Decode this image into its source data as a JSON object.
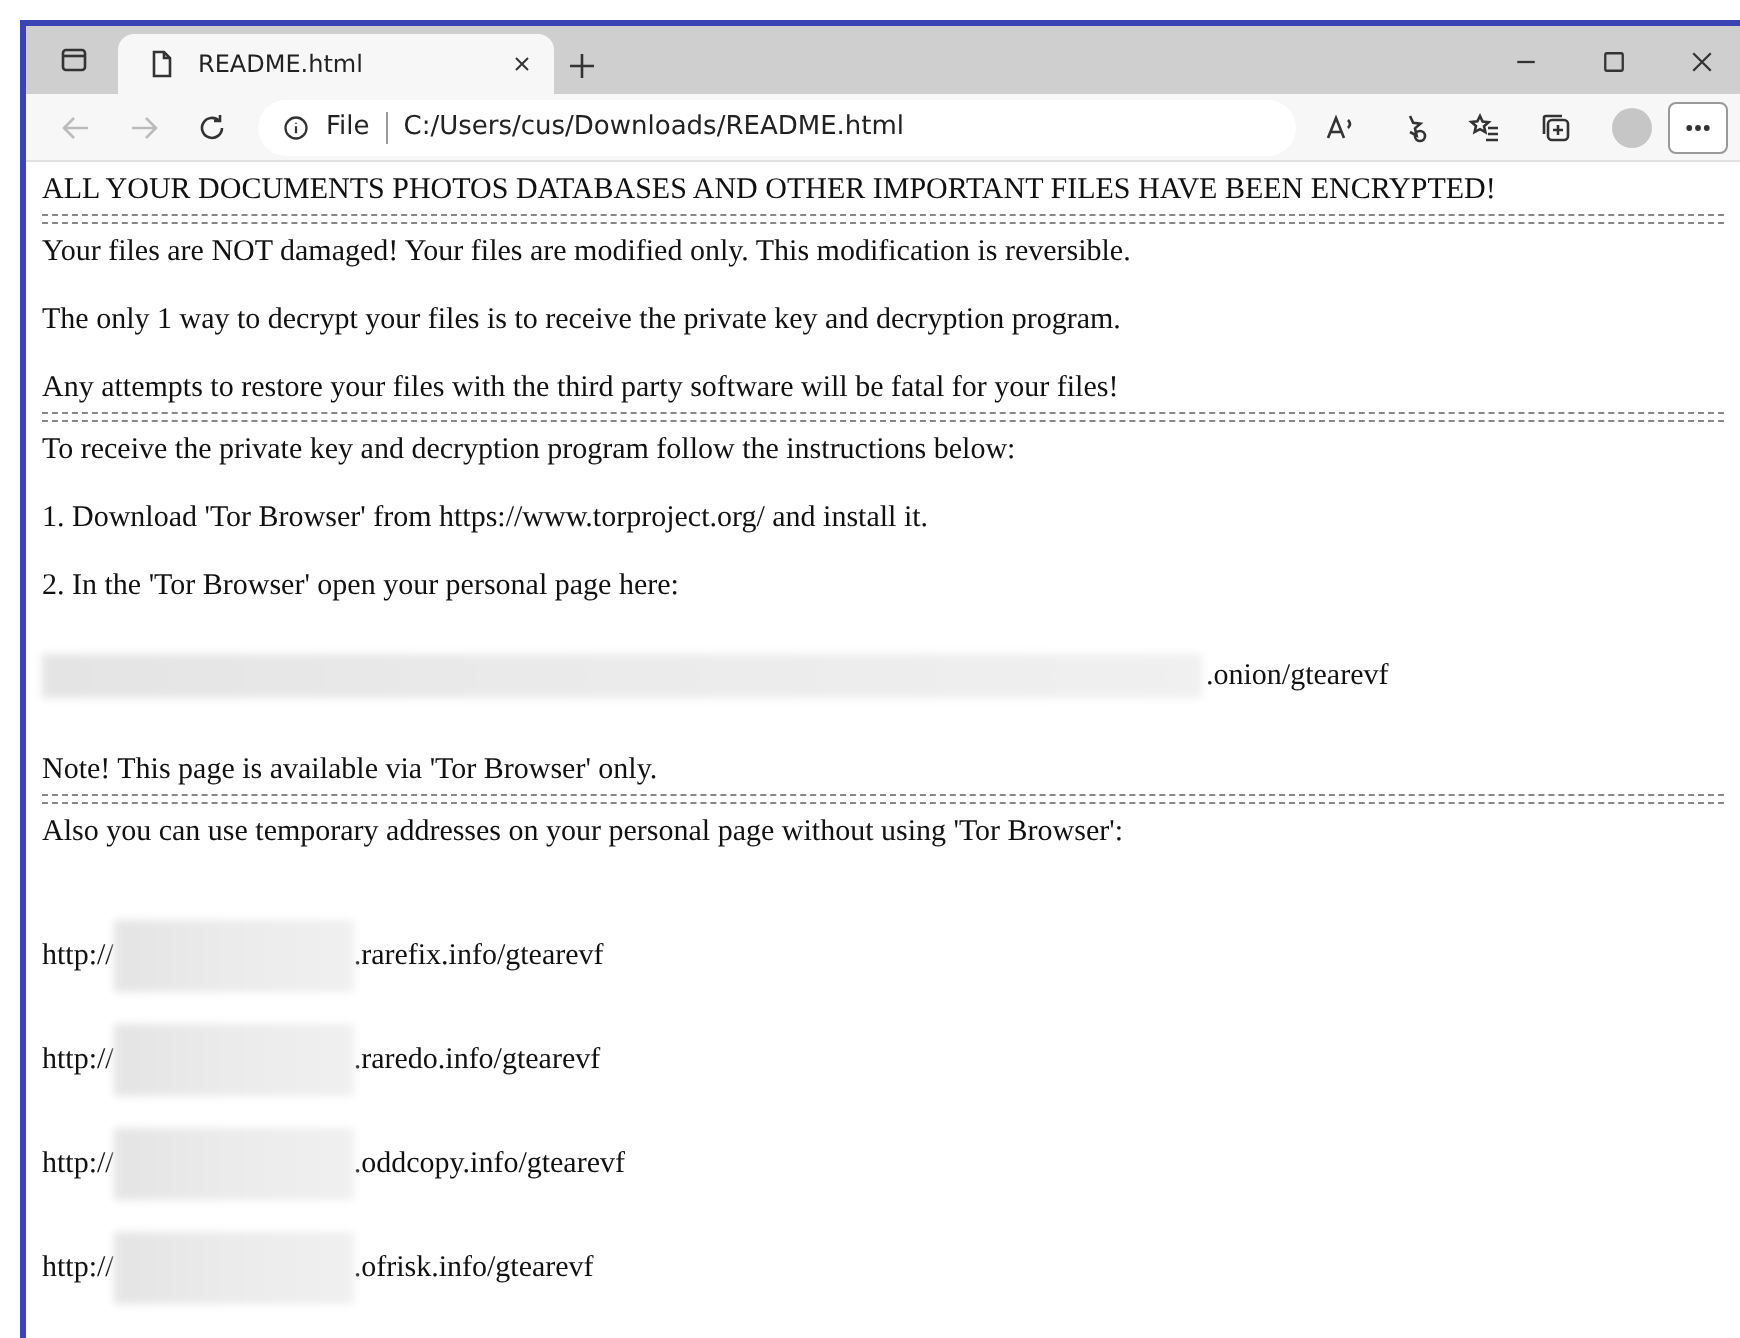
{
  "tabs": [
    {
      "title": "README.html",
      "selected": true
    }
  ],
  "address_bar": {
    "info_label": "File",
    "url": "C:/Users/cus/Downloads/README.html"
  },
  "page": [
    {
      "kind": "text",
      "text": "ALL YOUR DOCUMENTS PHOTOS DATABASES AND OTHER IMPORTANT FILES HAVE BEEN ENCRYPTED!"
    },
    {
      "kind": "divider"
    },
    {
      "kind": "text",
      "text": "Your files are NOT damaged! Your files are modified only. This modification is reversible."
    },
    {
      "kind": "text",
      "text": "The only 1 way to decrypt your files is to receive the private key and decryption program."
    },
    {
      "kind": "text",
      "text": "Any attempts to restore your files with the third party software will be fatal for your files!"
    },
    {
      "kind": "divider"
    },
    {
      "kind": "text",
      "text": "To receive the private key and decryption program follow the instructions below:"
    },
    {
      "kind": "text",
      "text": "1. Download 'Tor Browser' from https://www.torproject.org/ and install it."
    },
    {
      "kind": "text",
      "text": "2. In the 'Tor Browser' open your personal page here:"
    },
    {
      "kind": "onion",
      "suffix": ".onion/gtearevf"
    },
    {
      "kind": "text",
      "text": "Note! This page is available via 'Tor Browser' only."
    },
    {
      "kind": "divider"
    },
    {
      "kind": "text",
      "text": "Also you can use temporary addresses on your personal page without using 'Tor Browser':"
    },
    {
      "kind": "address",
      "prefix": "http://",
      "suffix": ".rarefix.info/gtearevf"
    },
    {
      "kind": "address",
      "prefix": "http://",
      "suffix": ".raredo.info/gtearevf"
    },
    {
      "kind": "address",
      "prefix": "http://",
      "suffix": ".oddcopy.info/gtearevf"
    },
    {
      "kind": "address",
      "prefix": "http://",
      "suffix": ".ofrisk.info/gtearevf"
    }
  ]
}
